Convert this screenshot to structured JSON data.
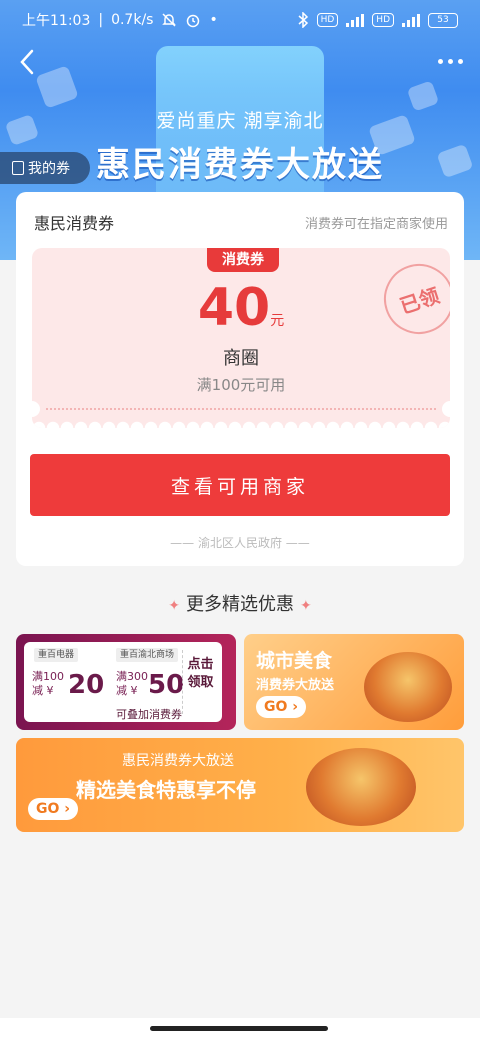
{
  "status_bar": {
    "time": "上午11:03",
    "speed": "0.7k/s",
    "battery": "53"
  },
  "header": {
    "slogan": "爱尚重庆 潮享渝北",
    "title": "惠民消费券大放送",
    "my_coupon": "我的券"
  },
  "coupon_card": {
    "title": "惠民消费券",
    "hint": "消费券可在指定商家使用",
    "tag": "消费券",
    "amount": "40",
    "unit": "元",
    "scope": "商圈",
    "condition": "满100元可用",
    "stamp": "已领",
    "button": "查看可用商家",
    "issuer": "—— 渝北区人民政府 ——"
  },
  "more": {
    "title": "更多精选优惠",
    "promo1": {
      "logo1": "重百电器",
      "logo2": "重百渝北商场",
      "c1_line1": "满100",
      "c1_line2": "减 ¥",
      "c1_amount": "20",
      "c2_line1": "满300",
      "c2_line2": "减 ¥",
      "c2_amount": "50",
      "claim": "点击领取",
      "stack": "可叠加消费券"
    },
    "promo2": {
      "title": "城市美食",
      "subtitle": "消费券大放送",
      "go": "GO"
    },
    "promo3": {
      "subtitle": "惠民消费券大放送",
      "title": "精选美食特惠享不停",
      "go": "GO"
    }
  },
  "colors": {
    "primary_red": "#ee3b3b",
    "banner_blue": "#3f8cf0",
    "promo_orange": "#ff9d3b",
    "promo_purple": "#7a1450"
  }
}
